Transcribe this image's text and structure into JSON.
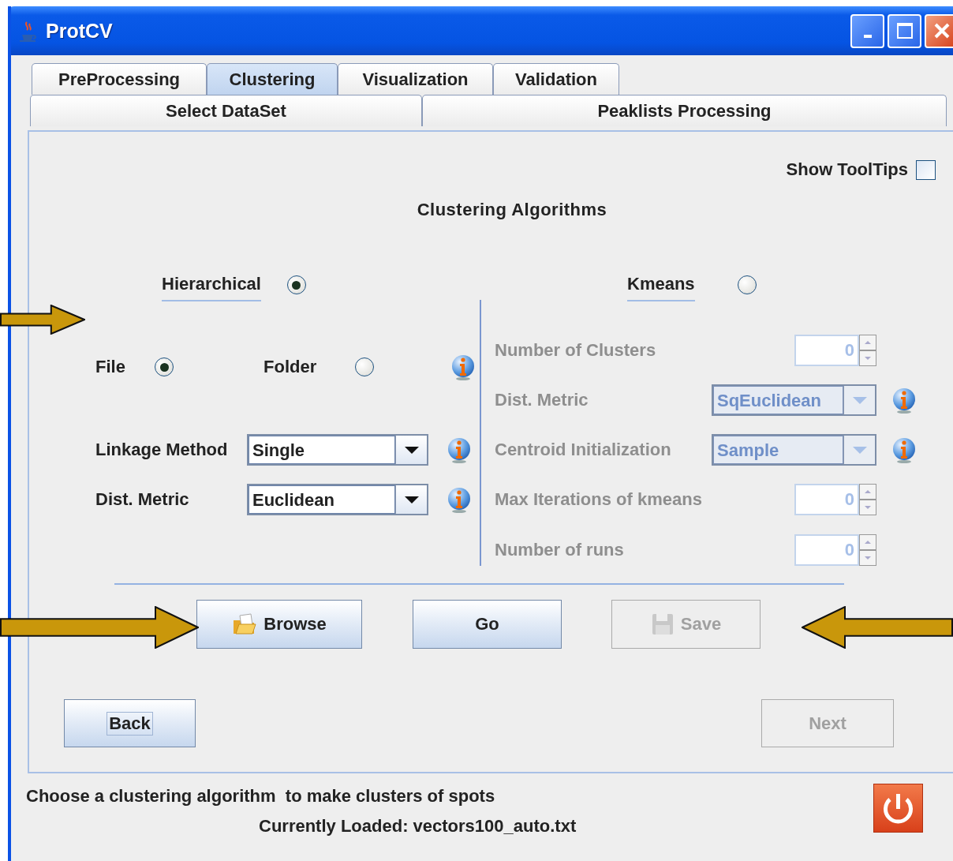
{
  "window": {
    "title": "ProtCV"
  },
  "tabs_row_1": [
    {
      "label": "PreProcessing",
      "selected": false
    },
    {
      "label": "Clustering",
      "selected": true
    },
    {
      "label": "Visualization",
      "selected": false
    },
    {
      "label": "Validation",
      "selected": false
    }
  ],
  "tabs_row_2": [
    {
      "label": "Select DataSet",
      "selected": false
    },
    {
      "label": "Peaklists Processing",
      "selected": false
    }
  ],
  "show_tooltips": {
    "label": "Show ToolTips",
    "checked": false
  },
  "heading": "Clustering Algorithms",
  "algorithms": [
    {
      "label": "Hierarchical",
      "selected": true
    },
    {
      "label": "Kmeans",
      "selected": false
    }
  ],
  "hierarchical": {
    "source": [
      {
        "label": "File",
        "selected": true
      },
      {
        "label": "Folder",
        "selected": false
      }
    ],
    "source_info": true,
    "fields": [
      {
        "label": "Linkage Method",
        "value": "Single",
        "info": true
      },
      {
        "label": "Dist. Metric",
        "value": "Euclidean",
        "info": true
      }
    ]
  },
  "kmeans": {
    "disabled": true,
    "fields": [
      {
        "kind": "spinner",
        "label": "Number of Clusters",
        "value": "0",
        "info": false
      },
      {
        "kind": "combo",
        "label": "Dist. Metric",
        "value": "SqEuclidean",
        "info": true
      },
      {
        "kind": "combo",
        "label": "Centroid Initialization",
        "value": "Sample",
        "info": true
      },
      {
        "kind": "spinner",
        "label": "Max Iterations of kmeans",
        "value": "0",
        "info": false
      },
      {
        "kind": "spinner",
        "label": "Number of runs",
        "value": "0",
        "info": false
      }
    ]
  },
  "actions": [
    {
      "label": "Browse",
      "kind": "folder",
      "disabled": false
    },
    {
      "label": "Go",
      "kind": "plain",
      "disabled": false
    },
    {
      "label": "Save",
      "kind": "disk",
      "disabled": true
    }
  ],
  "nav": [
    {
      "label": "Back",
      "disabled": false,
      "focused": true
    },
    {
      "label": "Next",
      "disabled": true,
      "focused": false
    }
  ],
  "status": {
    "message": "Choose a clustering algorithm  to make clusters of spots",
    "loaded": "Currently Loaded: vectors100_auto.txt"
  }
}
